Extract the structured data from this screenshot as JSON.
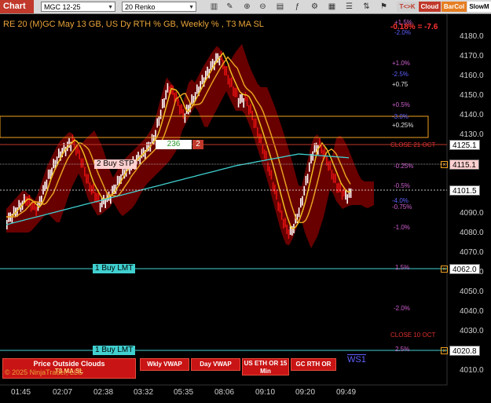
{
  "toolbar": {
    "tab_label": "Chart",
    "instrument": "MGC 12-25",
    "bar_type": "20 Renko",
    "buttons": [
      {
        "label": "T<>K",
        "bg": "#d0d0d0",
        "color": "#c0392b"
      },
      {
        "label": "Cloud",
        "bg": "#c0392b",
        "color": "#ffffff"
      },
      {
        "label": "BarCol",
        "bg": "#e67e22",
        "color": "#ffffff"
      },
      {
        "label": "SlowM",
        "bg": "#ffffff",
        "color": "#000000"
      }
    ]
  },
  "header": {
    "title": "RE 20  (M)GC May 13 GB, US Dy RTH % GB, Weekly % , T3 MA SL",
    "pct_readout": "-0.18% = -7.6"
  },
  "y_axis": {
    "ticks": [
      "4180.0",
      "4170.0",
      "4160.0",
      "4150.0",
      "4140.0",
      "4130.0",
      "4090.0",
      "4080.0",
      "4070.0",
      "4060.0",
      "4050.0",
      "4040.0",
      "4030.0",
      "4010.0"
    ]
  },
  "x_axis": {
    "ticks": [
      "01:45",
      "02:07",
      "02:38",
      "03:32",
      "05:35",
      "08:06",
      "09:10",
      "09:20",
      "09:49"
    ]
  },
  "price_tags": [
    {
      "value": "4125.1",
      "bg": "#ffffff",
      "color": "#000000"
    },
    {
      "value": "4115.1",
      "bg": "#ffd0d0",
      "color": "#000000"
    },
    {
      "value": "4101.5",
      "bg": "#ffffff",
      "color": "#000000"
    },
    {
      "value": "4062.0",
      "bg": "#ffffff",
      "color": "#000000"
    },
    {
      "value": "4020.8",
      "bg": "#ffffff",
      "color": "#000000"
    }
  ],
  "levels": {
    "plus_1_5": "+1.5%",
    "minus_2_0_top": "-2.0%",
    "plus_1_0": "+1.0%",
    "minus_2_5": "-2.5%",
    "plus_0_75": "+0.75",
    "plus_0_5": "+0.5%",
    "minus_3_0": "-3.0%",
    "plus_0_25": "+0.25%",
    "close_21_oct": "CLOSE 21 OCT",
    "minus_0_25": "-0.25%",
    "minus_0_5": "-0.5%",
    "minus_4_0": "-4.0%",
    "minus_0_75": "-0.75%",
    "minus_1_0": "-1.0%",
    "plus_1_5_low": "1.5%",
    "minus_2_0": "-2.0%",
    "close_10_oct": "CLOSE 10 OCT",
    "plus_2_5_low": "2.5%"
  },
  "orders": {
    "sell_qty": "236",
    "sell_count": "2",
    "buy_stp": "2 Buy STP",
    "buy_lmt_1": "1 Buy LMT",
    "buy_lmt_2": "1 Buy LMT"
  },
  "panel": {
    "main_label": "Price Outside Clouds",
    "sub_label": "T3 MA SL",
    "copyright": "© 2025 NinjaTrader, LLC",
    "buttons": [
      "Wkly VWAP",
      "Day VWAP",
      "US ETH OR 15 Min",
      "GC RTH OR"
    ],
    "ws_label": "WS1"
  },
  "colors": {
    "bull_brick": "#ffffff",
    "bear_brick": "#e01010",
    "cloud_red": "#8b0000",
    "ma_yellow": "#f0c020",
    "ma_orange": "#e8a020",
    "vwap_cyan": "#40d0d0"
  }
}
